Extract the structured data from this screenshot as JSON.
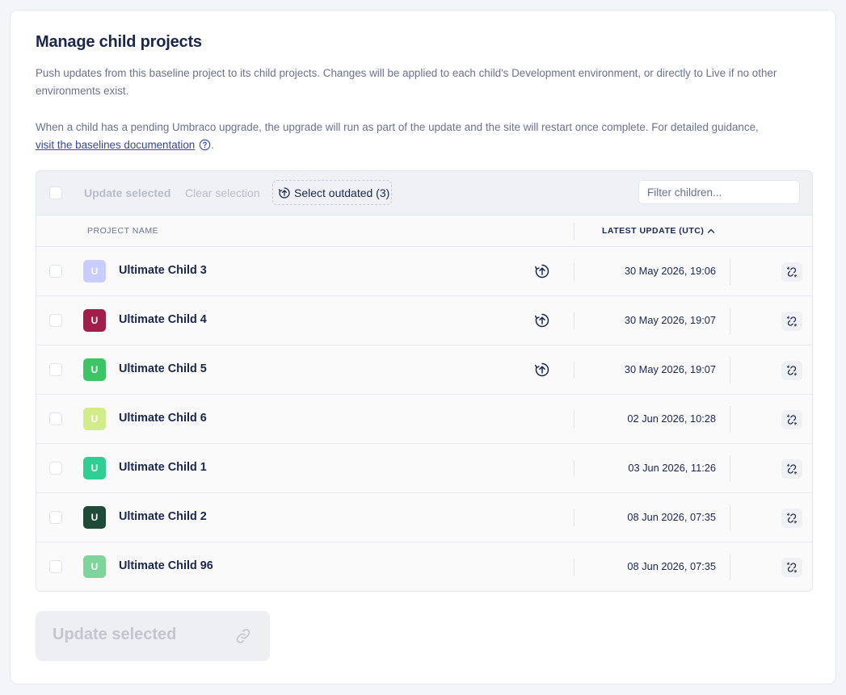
{
  "page": {
    "title": "Manage child projects",
    "description1": "Push updates from this baseline project to its child projects. Changes will be applied to each child's Development environment, or directly to Live if no other environments exist.",
    "description2": "When a child has a pending Umbraco upgrade, the upgrade will run as part of the update and the site will restart once complete. For detailed guidance,",
    "docs_link": "visit the baselines documentation",
    "docs_suffix": "."
  },
  "toolbar": {
    "update_selected": "Update selected",
    "clear_selection": "Clear selection",
    "select_outdated": "Select outdated (3)",
    "filter_placeholder": "Filter children..."
  },
  "table": {
    "col_name": "Project name",
    "col_date": "Latest update (UTC)",
    "sort_direction": "ascending",
    "rows": [
      {
        "initial": "U",
        "name": "Ultimate Child 3",
        "date": "30 May 2026, 19:06",
        "outdated": true,
        "color": "#c9cdfc"
      },
      {
        "initial": "U",
        "name": "Ultimate Child 4",
        "date": "30 May 2026, 19:07",
        "outdated": true,
        "color": "#a11e4a"
      },
      {
        "initial": "U",
        "name": "Ultimate Child 5",
        "date": "30 May 2026, 19:07",
        "outdated": true,
        "color": "#3cc466"
      },
      {
        "initial": "U",
        "name": "Ultimate Child 6",
        "date": "02 Jun 2026, 10:28",
        "outdated": false,
        "color": "#d2ec8c"
      },
      {
        "initial": "U",
        "name": "Ultimate Child 1",
        "date": "03 Jun 2026, 11:26",
        "outdated": false,
        "color": "#2fcf93"
      },
      {
        "initial": "U",
        "name": "Ultimate Child 2",
        "date": "08 Jun 2026, 07:35",
        "outdated": false,
        "color": "#1f4a37"
      },
      {
        "initial": "U",
        "name": "Ultimate Child 96",
        "date": "08 Jun 2026, 07:35",
        "outdated": false,
        "color": "#7ed49a"
      }
    ]
  },
  "footer": {
    "update_selected": "Update selected"
  },
  "icons": {
    "help": "question-circle-icon",
    "outdated": "upgrade-arrow-circle-icon",
    "sort": "chevron-up-icon",
    "row_action": "unlink-icon",
    "footer_action": "link-icon"
  },
  "colors": {
    "link": "#3544b1",
    "heading": "#1b264f",
    "muted_text": "#6a7290"
  }
}
